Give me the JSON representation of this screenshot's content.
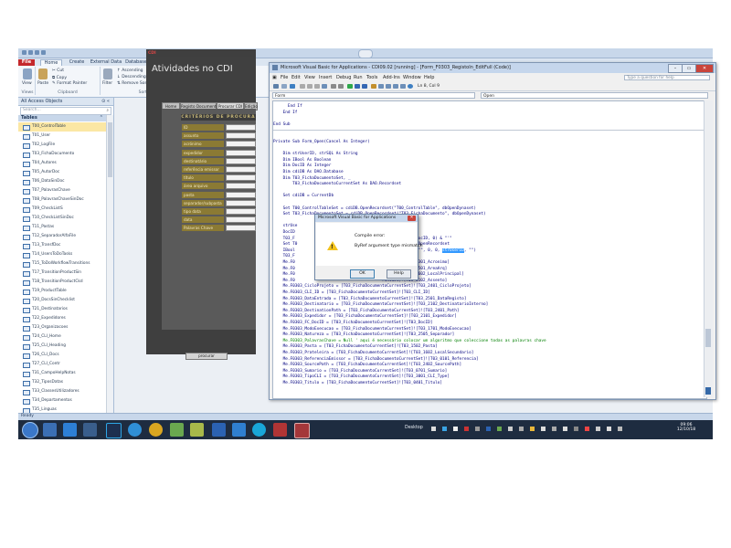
{
  "access": {
    "tabs": [
      "File",
      "Home",
      "Create",
      "External Data",
      "Database Tools"
    ],
    "ribbon": {
      "view": "View",
      "paste": "Paste",
      "cut": "Cut",
      "copy": "Copy",
      "format_painter": "Format Painter",
      "filter": "Filter",
      "ascending": "Ascending",
      "descending": "Descending",
      "remove_sort": "Remove Sort",
      "selection": "Selection",
      "advanced": "Advanced",
      "toggle_filter": "Toggle Filter",
      "groups": [
        "Views",
        "Clipboard",
        "Sort & Filter"
      ]
    },
    "nav": {
      "title": "All Access Objects",
      "search_placeholder": "Search...",
      "section": "Tables",
      "items": [
        "T00_ControlTable",
        "T01_User",
        "T02_LogFile",
        "T03_FichaDocumento",
        "T04_Autores",
        "T05_AutorDoc",
        "T06_DataSinDoc",
        "T07_PalavrasChave",
        "T08_PalavrasChaveSinDoc",
        "T09_CheckListS",
        "T10_CheckListSinDoc",
        "T11_Pastas",
        "T12_SeparadorAlfaFile",
        "T13_TransfDoc",
        "T14_UsersToDoTasks",
        "T15_ToDoWorkflowTransitions",
        "T17_TransitionProductSin",
        "T18_TransitionProductCkd",
        "T19_ProductTable",
        "T20_DocsSinChecklist",
        "T21_Destinatarios",
        "T22_Expedidores",
        "T23_Organizacoes",
        "T24_CLI_Home",
        "T25_CLI_Heading",
        "T26_CLI_Docs",
        "T27_CLI_Contr",
        "T31_CampoHelpNotas",
        "T32_TiposDatas",
        "T33_ClassesUtilizadores",
        "T34_Departamentos",
        "T35_Linguas",
        "T36_Separadores",
        "T37_AreaAnq"
      ],
      "selected_index": 0
    },
    "status": "Ready"
  },
  "form": {
    "logo_text": "CDI",
    "title": "Atividades no CDI",
    "tabs": [
      "Home",
      "Registo Documento",
      "Procurar CDI",
      "Edição"
    ],
    "criteria_heading": "CRITÉRIOS DE PROCURA",
    "fields": [
      "ID",
      "assunto",
      "acrónimo",
      "expedidor",
      "destinatário",
      "referência emissor",
      "título",
      "área arquivo",
      "pasta",
      "separador/subpasta",
      "tipo data",
      "data",
      "Palavras Chave"
    ],
    "search_button": "procurar"
  },
  "vba": {
    "title": "Microsoft Visual Basic for Applications - CDI09.02 [running] - [Form_F0303_RegistoIn_EditFull (Code)]",
    "menu": [
      "File",
      "Edit",
      "View",
      "Insert",
      "Debug",
      "Run",
      "Tools",
      "Add-Ins",
      "Window",
      "Help"
    ],
    "ask_placeholder": "Type a question for help",
    "cursor_pos": "Ln 8, Col 9",
    "object_combo": "Form",
    "procedure_combo": "Open",
    "code": [
      {
        "t": "      End If",
        "c": "blue"
      },
      {
        "t": "    End If",
        "c": "blue"
      },
      {
        "t": "",
        "c": "black"
      },
      {
        "t": "End Sub",
        "c": "blue"
      },
      {
        "t": "SEP",
        "c": "sep"
      },
      {
        "t": "",
        "c": "black"
      },
      {
        "t": "Private Sub Form_Open(Cancel As Integer)",
        "c": "blue"
      },
      {
        "t": "",
        "c": "black"
      },
      {
        "t": "    Dim strUserID, strSQL As String",
        "c": "blue"
      },
      {
        "t": "    Dim IBool As Boolean",
        "c": "blue"
      },
      {
        "t": "    Dim DocID As Integer",
        "c": "blue"
      },
      {
        "t": "    Dim cdiDB As DAO.Database",
        "c": "blue"
      },
      {
        "t": "    Dim T03_FichaDocumentoSet, _",
        "c": "blue"
      },
      {
        "t": "        T03_FichaDocumentoCurrentSet As DAO.Recordset",
        "c": "blue"
      },
      {
        "t": "",
        "c": "black"
      },
      {
        "t": "    Set cdiDB = CurrentDb",
        "c": "blue"
      },
      {
        "t": "",
        "c": "black"
      },
      {
        "t": "    Set T00_ControlTableSet = cdiDB.OpenRecordset(\"T00_ControlTable\", dbOpenDynaset)",
        "c": "blue"
      },
      {
        "t": "    Set T03_FichaDocumentoSet = cdiDB.OpenRecordset(\"T03_FichaDocumento\", dbOpenDynaset)",
        "c": "blue"
      },
      {
        "t": "",
        "c": "black"
      },
      {
        "t": "    strUse                                    UserID]",
        "c": "blue"
      },
      {
        "t": "    DocID",
        "c": "blue"
      },
      {
        "t": "    T03_F                                    = \"' & Format(DocID, 0) & \"'\"",
        "c": "blue"
      },
      {
        "t": "    Set T0                                    hDocumentoSet.OpenRecordset",
        "c": "blue"
      },
      {
        "t": "    IBool                                    Open\", \"\", \"\", \"\", 0, 0, ",
        "c": "blue",
        "hl": "strUserID",
        "after": ", \"\")"
      },
      {
        "t": "    T03_F",
        "c": "blue"
      },
      {
        "t": "    Me.F0                                    rentSet)![T03_0301_Acronimo]",
        "c": "blue"
      },
      {
        "t": "    Me.F0                                    rentSet)![T03_1501_AreaArq]",
        "c": "blue"
      },
      {
        "t": "    Me.F0                                    rentSet)![T03_1602_LocalPrincipal]",
        "c": "blue"
      },
      {
        "t": "    Me.F0                                    rentSet)![T03_0102_Assento]",
        "c": "blue"
      },
      {
        "t": "    Me.F0303_CicloProjeto = [T03_FichaDocumentoCurrentSet]![T03_2401_CicloProjeto]",
        "c": "blue"
      },
      {
        "t": "    Me.F0303_CLI_ID = [T03_FichaDocumentoCurrentSet]![T03_CLI_ID]",
        "c": "blue"
      },
      {
        "t": "    Me.F0303_DataEntrada = [T03_FichaDocumentoCurrentSet]![T03_2501_DataRegisto]",
        "c": "blue"
      },
      {
        "t": "    Me.F0303_Destinatario = [T03_FichaDocumentoCurrentSet]![T03_2102_DestinatarioInterno]",
        "c": "blue"
      },
      {
        "t": "    Me.F0303_DestinationPath = [T03_FichaDocumentoCurrentSet]![T03_2401_Path]",
        "c": "blue"
      },
      {
        "t": "    Me.F0303_Expedidor = [T03_FichaDocumentoCurrentSet]![T03_2101_Expedidor]",
        "c": "blue"
      },
      {
        "t": "    Me.F0303_FC_DocID = [T03_FichaDocumentoCurrentSet]![T03_DocID]",
        "c": "blue"
      },
      {
        "t": "    Me.F0303_ModoExecucao = [T03_FichaDocumentoCurrentSet]![T03_1701_ModoExecucao]",
        "c": "blue"
      },
      {
        "t": "    Me.F0303_Natureza = [T03_FichaDocumentoCurrentSet]![T03_2505_Separador]",
        "c": "blue"
      },
      {
        "t": "    Me.F0303_PalavrasChave = Null ' aqui é necessário colocar um algoritmo que coleccione todas as palavras chave",
        "c": "green"
      },
      {
        "t": "    Me.F0303_Pasta = [T03_FichaDocumentoCurrentSet]![T03_1502_Pasta]",
        "c": "blue"
      },
      {
        "t": "    Me.F0303_Prateleira = [T03_FichaDocumentoCurrentSet]![T03_1602_LocalSecundario]",
        "c": "blue"
      },
      {
        "t": "    Me.F0303_ReferenciaEmissor = [T03_FichaDocumentoCurrentSet]![T03_0101_Referencia]",
        "c": "blue"
      },
      {
        "t": "    Me.F0303_SourcePath = [T03_FichaDocumentoCurrentSet]![T03_2402_SourcePath]",
        "c": "blue"
      },
      {
        "t": "    Me.F0303_Sumario = [T03_FichaDocumentoCurrentSet]![T03_0701_Sumario]",
        "c": "blue"
      },
      {
        "t": "    Me.F0303_TipoCLI = [T03_FichaDocumentoCurrentSet]![T03_3001_CLI_Type]",
        "c": "blue"
      },
      {
        "t": "    Me.F0303_Titulo = [T03_FichaDocumentoCurrentSet]![T03_0401_Titulo]",
        "c": "blue"
      }
    ]
  },
  "dialog": {
    "title": "Microsoft Visual Basic for Applications",
    "heading": "Compile error:",
    "message": "ByRef argument type mismatch",
    "ok": "OK",
    "help": "Help"
  },
  "taskbar": {
    "tray_label": "Desktop",
    "time": "09:06",
    "date": "12/10/18"
  }
}
